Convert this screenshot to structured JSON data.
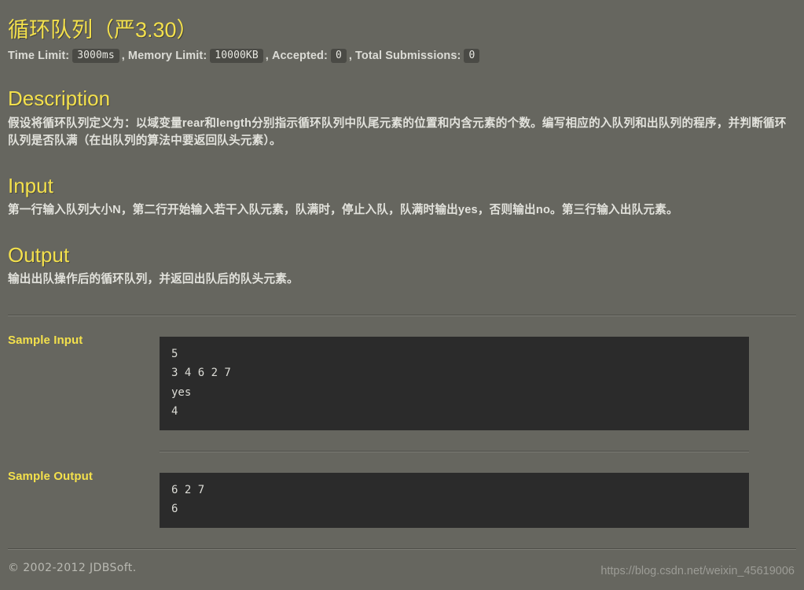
{
  "problem": {
    "title": "循环队列（严3.30）",
    "limits": {
      "time_label": "Time Limit:",
      "time_value": "3000ms",
      "comma1": ",",
      "memory_label": "Memory Limit:",
      "memory_value": "10000KB",
      "comma2": ",",
      "accepted_label": "Accepted:",
      "accepted_value": "0",
      "comma3": ",",
      "submissions_label": "Total Submissions:",
      "submissions_value": "0"
    }
  },
  "sections": {
    "description": {
      "heading": "Description",
      "body": "假设将循环队列定义为：以域变量rear和length分别指示循环队列中队尾元素的位置和内含元素的个数。编写相应的入队列和出队列的程序，并判断循环队列是否队满（在出队列的算法中要返回队头元素）。"
    },
    "input": {
      "heading": "Input",
      "body": "第一行输入队列大小N，第二行开始输入若干入队元素，队满时，停止入队，队满时输出yes，否则输出no。第三行输入出队元素。"
    },
    "output": {
      "heading": "Output",
      "body": "输出出队操作后的循环队列，并返回出队后的队头元素。"
    }
  },
  "samples": {
    "input": {
      "label": "Sample Input",
      "code": "5\n3 4 6 2 7\nyes\n4"
    },
    "output": {
      "label": "Sample Output",
      "code": "6 2 7\n6"
    }
  },
  "footer": {
    "copyright": "© 2002-2012  JDBSoft.",
    "watermark": "https://blog.csdn.net/weixin_45619006"
  },
  "colors": {
    "page_background": "#66665f",
    "accent_yellow": "#f3e04c",
    "body_text": "#e2e2dc",
    "code_background": "#2b2b2b",
    "chip_background": "#4a4a45"
  }
}
